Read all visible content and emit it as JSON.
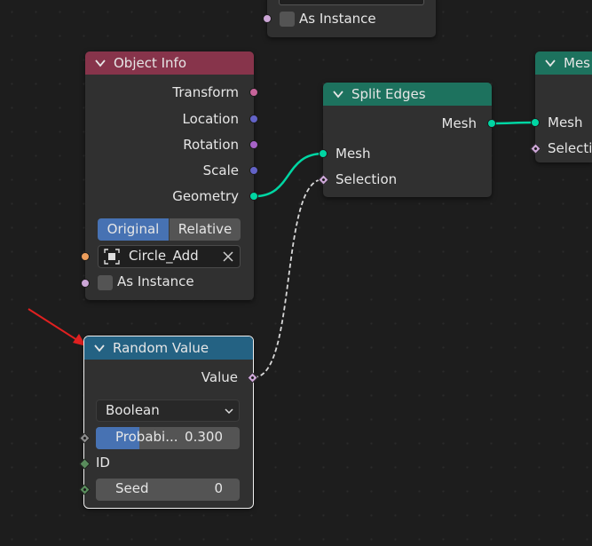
{
  "colors": {
    "object_info_header": "#87344b",
    "geometry_header": "#1d725e",
    "converter_header": "#246283",
    "geometry_socket": "#00d6a3",
    "vector_socket": "#6363c7",
    "rotation_socket": "#a663c7",
    "matrix_socket": "#c7649a",
    "boolean_socket": "#cca6d6",
    "integer_socket": "#598c5c",
    "object_socket": "#ed9e5c",
    "selected_button": "#4772b3",
    "arrow": "#e02020"
  },
  "top_node": {
    "checkbox_label": "As Instance"
  },
  "object_info": {
    "title": "Object Info",
    "chevron": "chevron-down-icon",
    "outputs": [
      "Transform",
      "Location",
      "Rotation",
      "Scale",
      "Geometry"
    ],
    "toggle": {
      "original": "Original",
      "relative": "Relative",
      "selected": "Original"
    },
    "object_field": {
      "value": "Circle_Add",
      "clear_icon": "close-icon",
      "type_icon": "object-icon"
    },
    "as_instance": "As Instance"
  },
  "split_edges": {
    "title": "Split Edges",
    "output": "Mesh",
    "inputs": [
      "Mesh",
      "Selection"
    ]
  },
  "right_node": {
    "title": "Mes",
    "inputs": [
      "Mesh",
      "Selectio"
    ]
  },
  "random_value": {
    "title": "Random Value",
    "output": "Value",
    "data_type": "Boolean",
    "probability_label": "Probabi...",
    "probability_value": "0.300",
    "probability_fraction": 0.3,
    "id_label": "ID",
    "seed_label": "Seed",
    "seed_value": "0"
  }
}
